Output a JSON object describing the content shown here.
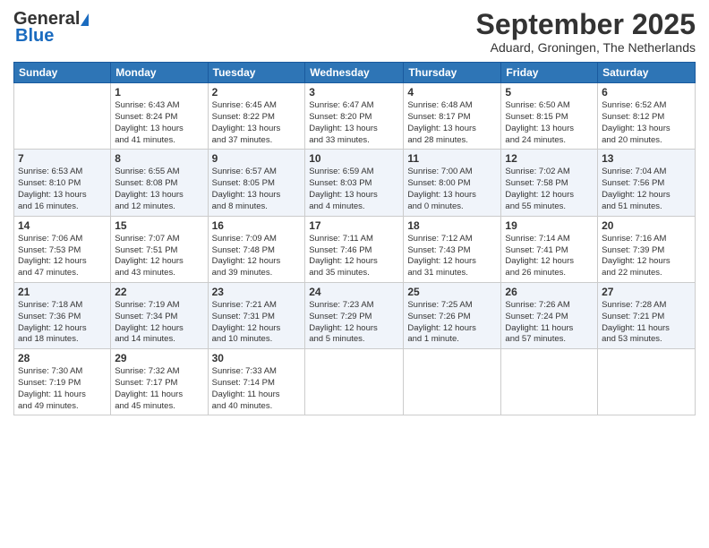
{
  "header": {
    "logo_general": "General",
    "logo_blue": "Blue",
    "month_title": "September 2025",
    "location": "Aduard, Groningen, The Netherlands"
  },
  "days_of_week": [
    "Sunday",
    "Monday",
    "Tuesday",
    "Wednesday",
    "Thursday",
    "Friday",
    "Saturday"
  ],
  "weeks": [
    [
      {
        "day": "",
        "info": ""
      },
      {
        "day": "1",
        "info": "Sunrise: 6:43 AM\nSunset: 8:24 PM\nDaylight: 13 hours\nand 41 minutes."
      },
      {
        "day": "2",
        "info": "Sunrise: 6:45 AM\nSunset: 8:22 PM\nDaylight: 13 hours\nand 37 minutes."
      },
      {
        "day": "3",
        "info": "Sunrise: 6:47 AM\nSunset: 8:20 PM\nDaylight: 13 hours\nand 33 minutes."
      },
      {
        "day": "4",
        "info": "Sunrise: 6:48 AM\nSunset: 8:17 PM\nDaylight: 13 hours\nand 28 minutes."
      },
      {
        "day": "5",
        "info": "Sunrise: 6:50 AM\nSunset: 8:15 PM\nDaylight: 13 hours\nand 24 minutes."
      },
      {
        "day": "6",
        "info": "Sunrise: 6:52 AM\nSunset: 8:12 PM\nDaylight: 13 hours\nand 20 minutes."
      }
    ],
    [
      {
        "day": "7",
        "info": "Sunrise: 6:53 AM\nSunset: 8:10 PM\nDaylight: 13 hours\nand 16 minutes."
      },
      {
        "day": "8",
        "info": "Sunrise: 6:55 AM\nSunset: 8:08 PM\nDaylight: 13 hours\nand 12 minutes."
      },
      {
        "day": "9",
        "info": "Sunrise: 6:57 AM\nSunset: 8:05 PM\nDaylight: 13 hours\nand 8 minutes."
      },
      {
        "day": "10",
        "info": "Sunrise: 6:59 AM\nSunset: 8:03 PM\nDaylight: 13 hours\nand 4 minutes."
      },
      {
        "day": "11",
        "info": "Sunrise: 7:00 AM\nSunset: 8:00 PM\nDaylight: 13 hours\nand 0 minutes."
      },
      {
        "day": "12",
        "info": "Sunrise: 7:02 AM\nSunset: 7:58 PM\nDaylight: 12 hours\nand 55 minutes."
      },
      {
        "day": "13",
        "info": "Sunrise: 7:04 AM\nSunset: 7:56 PM\nDaylight: 12 hours\nand 51 minutes."
      }
    ],
    [
      {
        "day": "14",
        "info": "Sunrise: 7:06 AM\nSunset: 7:53 PM\nDaylight: 12 hours\nand 47 minutes."
      },
      {
        "day": "15",
        "info": "Sunrise: 7:07 AM\nSunset: 7:51 PM\nDaylight: 12 hours\nand 43 minutes."
      },
      {
        "day": "16",
        "info": "Sunrise: 7:09 AM\nSunset: 7:48 PM\nDaylight: 12 hours\nand 39 minutes."
      },
      {
        "day": "17",
        "info": "Sunrise: 7:11 AM\nSunset: 7:46 PM\nDaylight: 12 hours\nand 35 minutes."
      },
      {
        "day": "18",
        "info": "Sunrise: 7:12 AM\nSunset: 7:43 PM\nDaylight: 12 hours\nand 31 minutes."
      },
      {
        "day": "19",
        "info": "Sunrise: 7:14 AM\nSunset: 7:41 PM\nDaylight: 12 hours\nand 26 minutes."
      },
      {
        "day": "20",
        "info": "Sunrise: 7:16 AM\nSunset: 7:39 PM\nDaylight: 12 hours\nand 22 minutes."
      }
    ],
    [
      {
        "day": "21",
        "info": "Sunrise: 7:18 AM\nSunset: 7:36 PM\nDaylight: 12 hours\nand 18 minutes."
      },
      {
        "day": "22",
        "info": "Sunrise: 7:19 AM\nSunset: 7:34 PM\nDaylight: 12 hours\nand 14 minutes."
      },
      {
        "day": "23",
        "info": "Sunrise: 7:21 AM\nSunset: 7:31 PM\nDaylight: 12 hours\nand 10 minutes."
      },
      {
        "day": "24",
        "info": "Sunrise: 7:23 AM\nSunset: 7:29 PM\nDaylight: 12 hours\nand 5 minutes."
      },
      {
        "day": "25",
        "info": "Sunrise: 7:25 AM\nSunset: 7:26 PM\nDaylight: 12 hours\nand 1 minute."
      },
      {
        "day": "26",
        "info": "Sunrise: 7:26 AM\nSunset: 7:24 PM\nDaylight: 11 hours\nand 57 minutes."
      },
      {
        "day": "27",
        "info": "Sunrise: 7:28 AM\nSunset: 7:21 PM\nDaylight: 11 hours\nand 53 minutes."
      }
    ],
    [
      {
        "day": "28",
        "info": "Sunrise: 7:30 AM\nSunset: 7:19 PM\nDaylight: 11 hours\nand 49 minutes."
      },
      {
        "day": "29",
        "info": "Sunrise: 7:32 AM\nSunset: 7:17 PM\nDaylight: 11 hours\nand 45 minutes."
      },
      {
        "day": "30",
        "info": "Sunrise: 7:33 AM\nSunset: 7:14 PM\nDaylight: 11 hours\nand 40 minutes."
      },
      {
        "day": "",
        "info": ""
      },
      {
        "day": "",
        "info": ""
      },
      {
        "day": "",
        "info": ""
      },
      {
        "day": "",
        "info": ""
      }
    ]
  ]
}
